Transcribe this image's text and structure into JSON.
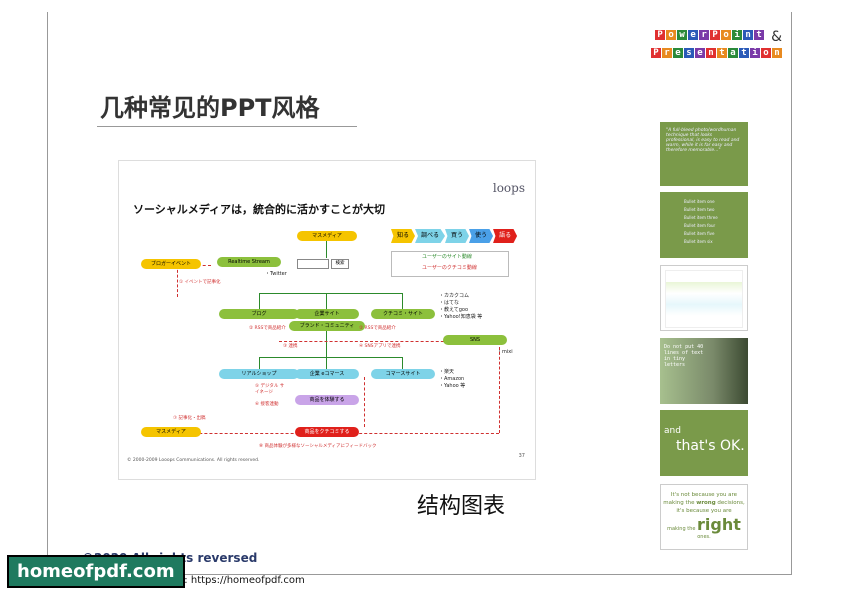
{
  "header": {
    "logo_line1": [
      "P",
      "o",
      "w",
      "e",
      "r",
      "P",
      "o",
      "i",
      "n",
      "t"
    ],
    "logo_amp": "&",
    "logo_line2": [
      "P",
      "r",
      "e",
      "s",
      "e",
      "n",
      "t",
      "a",
      "t",
      "i",
      "o",
      "n"
    ],
    "logo_colors": [
      "#e03030",
      "#e88a20",
      "#2a8a3a",
      "#2a5ab8",
      "#7a3aa8"
    ]
  },
  "title": "几种常见的PPT风格",
  "slide": {
    "logo": "loops",
    "heading": "ソーシャルメディアは，統合的に活かすことが大切",
    "flow": [
      "知る",
      "調べる",
      "買う",
      "使う",
      "語る"
    ],
    "flow_colors": [
      "#f5c400",
      "#7ed3e8",
      "#7ed3e8",
      "#4aa0e8",
      "#e0201b"
    ],
    "legend": [
      "ユーザーのサイト動線",
      "ユーザーのクチコミ動線"
    ],
    "nodes": {
      "mass_media_top": "マスメディア",
      "blogger_event": "ブロガーイベント",
      "realtime_stream": "Realtime Stream",
      "twitter": "・Twitter",
      "search_button": "検索",
      "blog": "ブログ",
      "corp_site": "企業サイト",
      "brand_community": "ブランド・コミュニティ",
      "kuchikomi_site": "クチコミ・サイト",
      "sns": "SNS",
      "real_shop": "リアルショップ",
      "corp_ec": "企業 eコマース",
      "commerce_site": "コマースサイト",
      "product_exp": "商品を体験する",
      "product_kuchikomi": "商品をクチコミする",
      "mass_media_bottom": "マスメディア"
    },
    "side_lists": {
      "kuchikomi": [
        "・カカクコム",
        "・はてな",
        "・教えてgoo",
        "・Yahoo!知恵袋 等"
      ],
      "sns": "・mixi",
      "commerce": [
        "・楽天",
        "・Amazon",
        "・Yahoo 等"
      ]
    },
    "notes": [
      "① イベントで記事化",
      "② RSSで商品紹介",
      "② RSSで商品紹介",
      "③ 連携",
      "④ SNSアプリで連携",
      "⑤ デジタル サイネージ",
      "⑥ 接客連動",
      "⑦ 記事化・出稿",
      "⑧ 商品体験が多様なソーシャルメディアにフィードバック"
    ],
    "footer": "© 2000-2009  Looops Communications. All rights reserved.",
    "page_number": "37"
  },
  "caption": "结构图表",
  "thumbnails": {
    "t1_text": "\"A full-bleed photo/wordhuman technique that looks professional, is easy to read and warm, while it is far easy and therefore memorable...\"",
    "t2_items": [
      "Bullet item one",
      "Bullet item two",
      "Bullet item three",
      "Bullet item four",
      "Bullet item five",
      "Bullet item six"
    ],
    "t4_text": "Do not put 40 lines of text in tiny letters",
    "t5_and": "and",
    "t5_ok": "that's OK.",
    "t6_line1": "It's not because you are",
    "t6_line2a": "making the",
    "t6_wrong": "wrong",
    "t6_line2b": "decisions,",
    "t6_line3": "it's because you are",
    "t6_line4a": "making the",
    "t6_right": "right",
    "t6_line4b": "ones."
  },
  "footer": {
    "copyright": "©2020 All rights reversed",
    "visit": "Visit: https://homeofpdf.com",
    "watermark": "homeofpdf.com"
  }
}
